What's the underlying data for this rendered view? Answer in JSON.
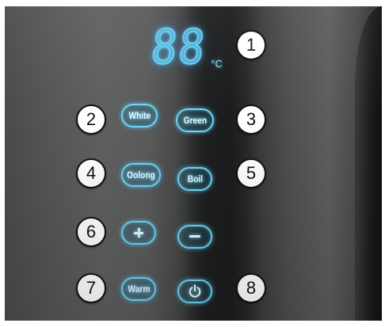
{
  "display": {
    "digits": "88",
    "unit": "°C"
  },
  "badges": [
    "1",
    "2",
    "3",
    "4",
    "5",
    "6",
    "7",
    "8"
  ],
  "buttons": {
    "white": "White",
    "green": "Green",
    "oolong": "Oolong",
    "boil": "Boil",
    "warm": "Warm"
  },
  "icons": {
    "plus": "plus-icon",
    "minus": "minus-icon",
    "power": "power-icon"
  },
  "colors": {
    "glow": "#6ed6f7",
    "badge_bg": "#ffffff",
    "badge_border": "#111111"
  }
}
